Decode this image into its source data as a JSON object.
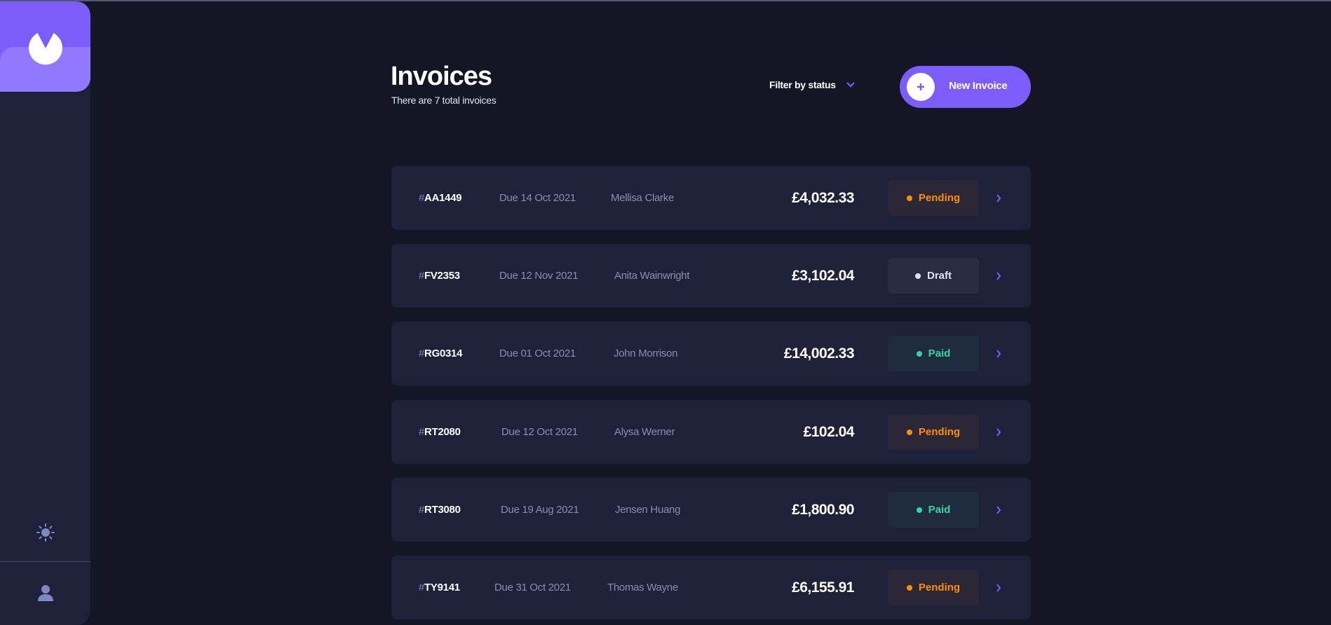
{
  "header": {
    "title": "Invoices",
    "subtitle": "There are 7 total invoices",
    "filter_label": "Filter by status",
    "new_invoice_label": "New Invoice"
  },
  "sidebar": {
    "logo_icon": "logo-icon",
    "theme_icon": "sun-icon",
    "avatar_icon": "user-icon"
  },
  "colors": {
    "accent": "#7c5dfa",
    "pending": "#ff8f00",
    "paid": "#33d69f",
    "draft": "#dfe3fa",
    "background": "#141625",
    "card": "#1e2139"
  },
  "invoices": [
    {
      "hash": "#",
      "id": "AA1449",
      "due": "Due 14 Oct 2021",
      "client": "Mellisa Clarke",
      "amount": "£4,032.33",
      "status": "Pending",
      "status_key": "pending"
    },
    {
      "hash": "#",
      "id": "FV2353",
      "due": "Due 12 Nov 2021",
      "client": "Anita Wainwright",
      "amount": "£3,102.04",
      "status": "Draft",
      "status_key": "draft"
    },
    {
      "hash": "#",
      "id": "RG0314",
      "due": "Due 01 Oct 2021",
      "client": "John Morrison",
      "amount": "£14,002.33",
      "status": "Paid",
      "status_key": "paid"
    },
    {
      "hash": "#",
      "id": "RT2080",
      "due": "Due 12 Oct 2021",
      "client": "Alysa Werner",
      "amount": "£102.04",
      "status": "Pending",
      "status_key": "pending"
    },
    {
      "hash": "#",
      "id": "RT3080",
      "due": "Due 19 Aug 2021",
      "client": "Jensen Huang",
      "amount": "£1,800.90",
      "status": "Paid",
      "status_key": "paid"
    },
    {
      "hash": "#",
      "id": "TY9141",
      "due": "Due 31 Oct 2021",
      "client": "Thomas Wayne",
      "amount": "£6,155.91",
      "status": "Pending",
      "status_key": "pending"
    }
  ]
}
